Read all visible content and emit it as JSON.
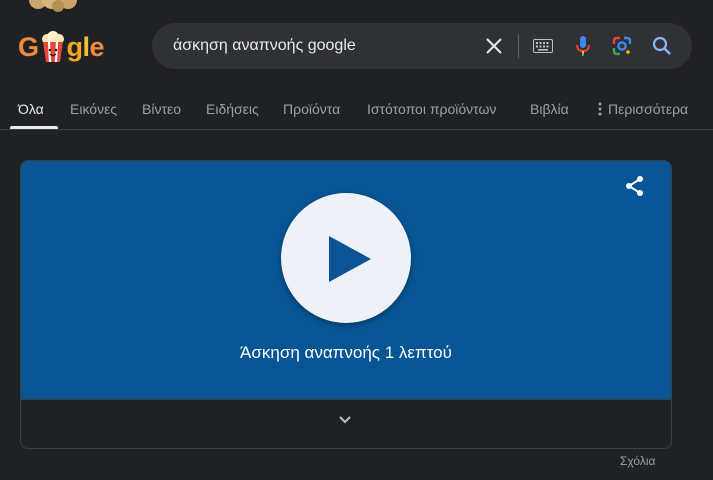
{
  "logo": {
    "letters": [
      "G",
      "g",
      "l",
      "e"
    ]
  },
  "search": {
    "query": "άσκηση αναπνοής google"
  },
  "icons": {
    "clear": "close-icon",
    "keyboard": "keyboard-icon",
    "mic": "microphone-icon",
    "lens": "google-lens-icon",
    "search": "search-icon",
    "share": "share-icon",
    "play": "play-icon",
    "expand": "chevron-down-icon",
    "more": "more-vert-icon"
  },
  "tabs": [
    {
      "label": "Όλα",
      "active": true
    },
    {
      "label": "Εικόνες"
    },
    {
      "label": "Βίντεο"
    },
    {
      "label": "Ειδήσεις"
    },
    {
      "label": "Προϊόντα"
    },
    {
      "label": "Ιστότοποι προϊόντων"
    },
    {
      "label": "Βιβλία"
    },
    {
      "label": "Περισσότερα"
    }
  ],
  "card": {
    "title": "Άσκηση αναπνοής 1 λεπτού"
  },
  "feedback_label": "Σχόλια",
  "colors": {
    "background": "#202124",
    "panel": "#075594",
    "searchbox": "#303134"
  }
}
